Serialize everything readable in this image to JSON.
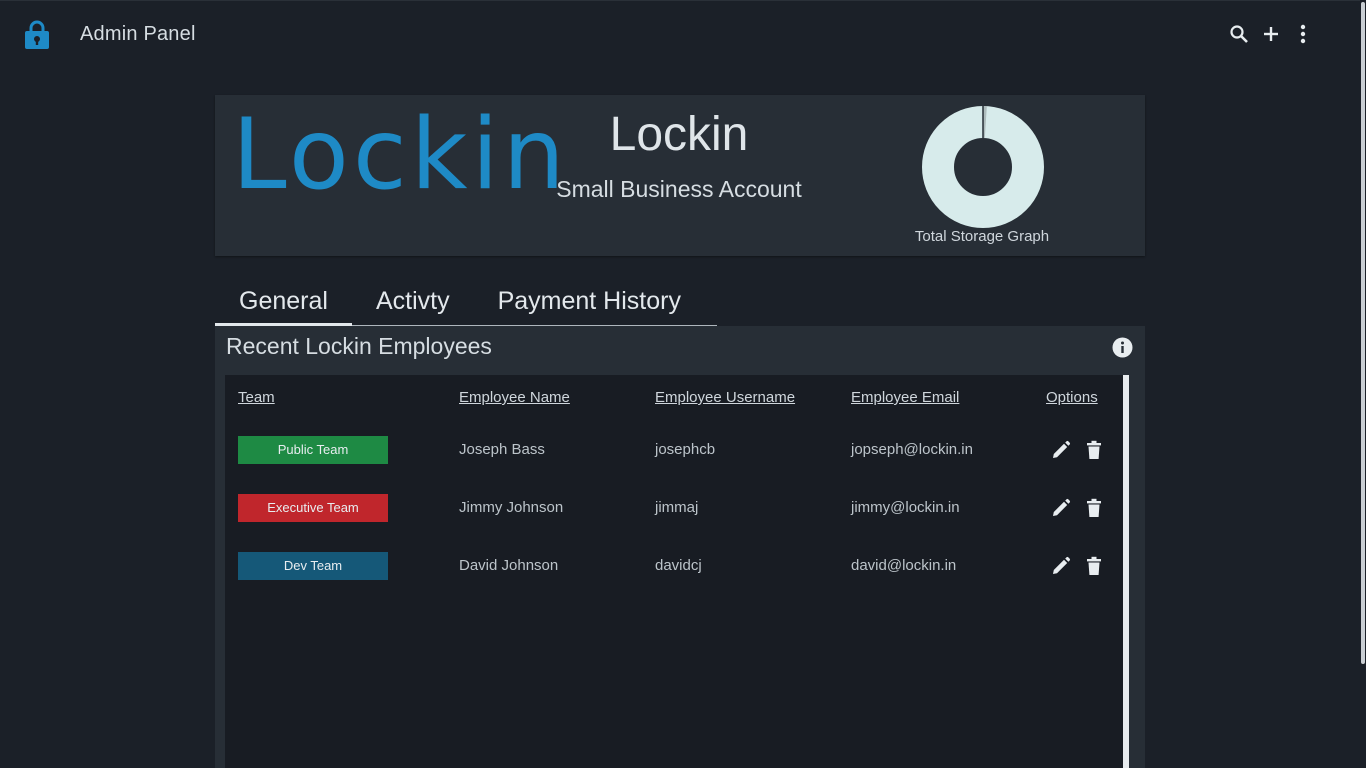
{
  "app": {
    "title": "Admin Panel"
  },
  "topbar": {
    "actions": [
      {
        "icon": "search-icon"
      },
      {
        "icon": "plus-icon"
      },
      {
        "icon": "more-vert-icon"
      }
    ]
  },
  "hero": {
    "logo_text": "Lockin",
    "title": "Lockin",
    "subtitle": "Small Business Account",
    "storage_label": "Total Storage Graph",
    "storage_used_fraction": 0.01
  },
  "tabs": [
    {
      "label": "General",
      "active": true
    },
    {
      "label": "Activty",
      "active": false
    },
    {
      "label": "Payment History",
      "active": false
    }
  ],
  "employees": {
    "title": "Recent Lockin Employees",
    "columns": [
      "Team",
      "Employee Name",
      "Employee Username",
      "Employee Email",
      "Options"
    ],
    "rows": [
      {
        "team": "Public Team",
        "team_color": "#1e8a44",
        "name": "Joseph Bass",
        "username": "josephcb",
        "email": "jopseph@lockin.in"
      },
      {
        "team": "Executive Team",
        "team_color": "#c0262c",
        "name": "Jimmy Johnson",
        "username": "jimmaj",
        "email": "jimmy@lockin.in"
      },
      {
        "team": "Dev Team",
        "team_color": "#155878",
        "name": "David Johnson",
        "username": "davidcj",
        "email": "david@lockin.in"
      }
    ]
  },
  "colors": {
    "accent": "#1e8ac6",
    "background": "#1b2028",
    "card": "#272e36",
    "table": "#181c23"
  }
}
